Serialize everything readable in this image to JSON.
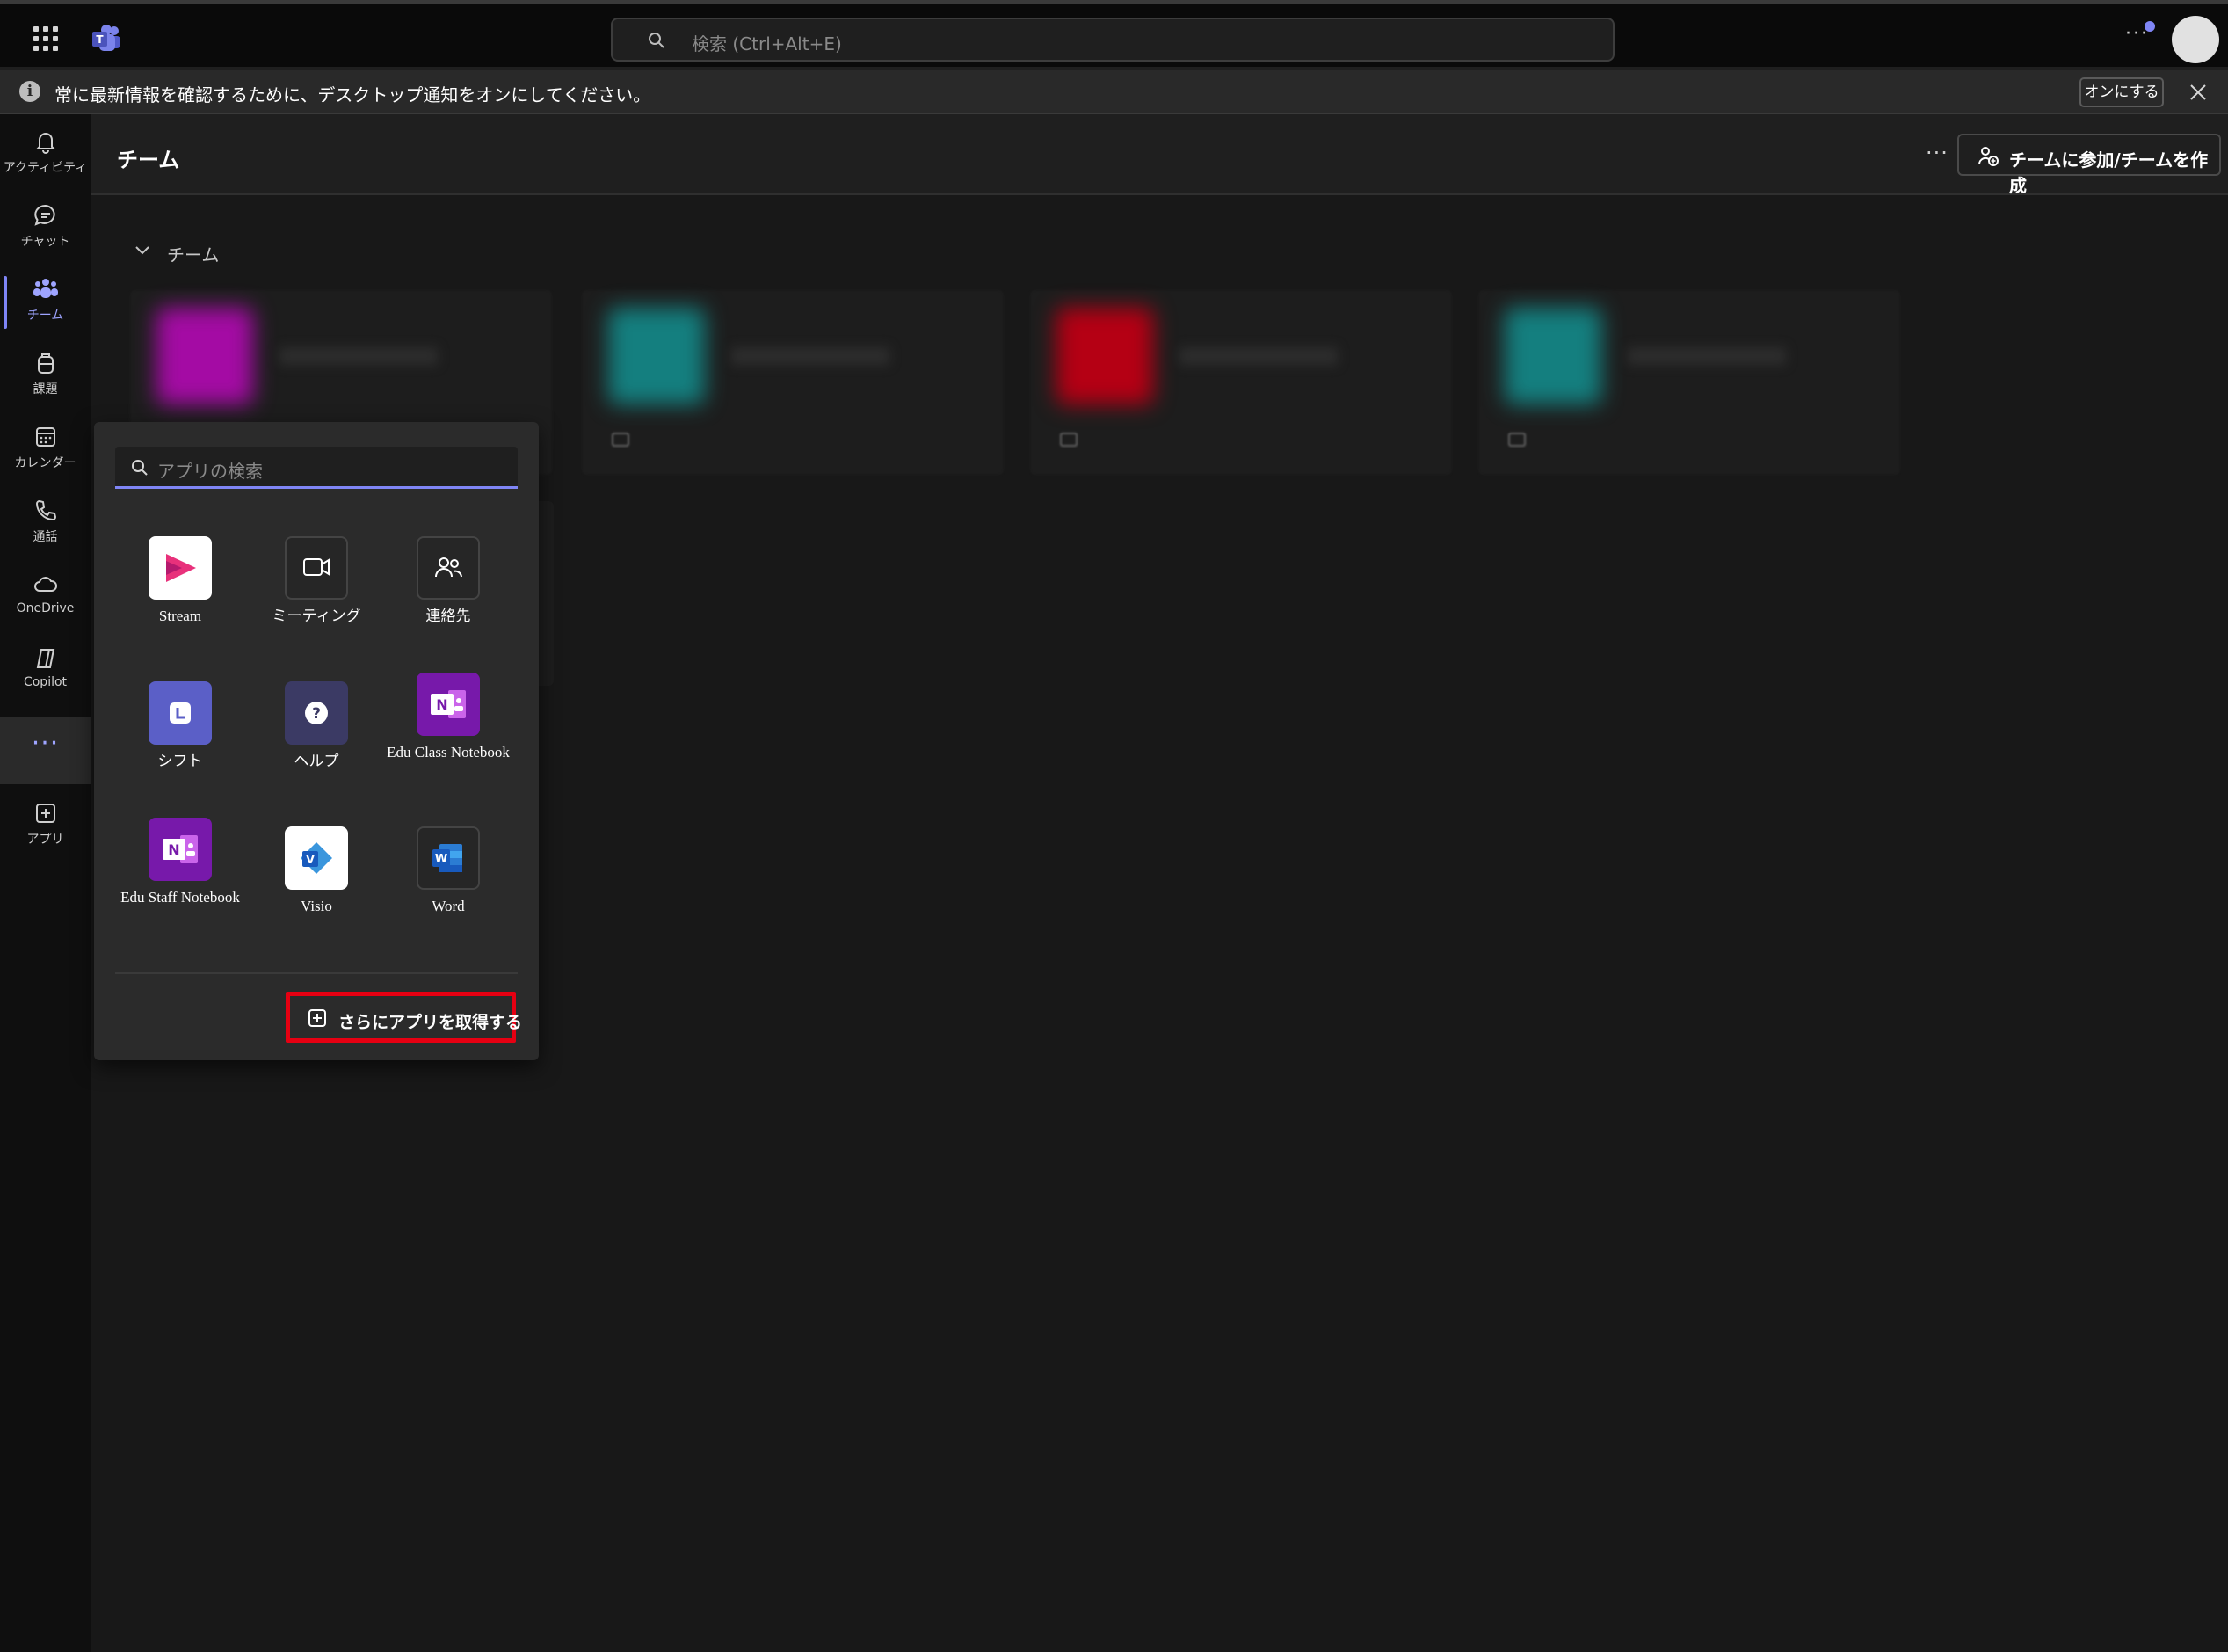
{
  "topbar": {
    "search_placeholder": "検索 (Ctrl+Alt+E)",
    "more_label": "···"
  },
  "notification": {
    "message": "常に最新情報を確認するために、デスクトップ通知をオンにしてください。",
    "turn_on_label": "オンにする"
  },
  "rail": {
    "items": [
      {
        "label": "アクティビティ",
        "icon": "bell-icon"
      },
      {
        "label": "チャット",
        "icon": "chat-icon"
      },
      {
        "label": "チーム",
        "icon": "teams-icon",
        "active": true
      },
      {
        "label": "課題",
        "icon": "backpack-icon"
      },
      {
        "label": "カレンダー",
        "icon": "calendar-icon"
      },
      {
        "label": "通話",
        "icon": "phone-icon"
      },
      {
        "label": "OneDrive",
        "icon": "cloud-icon"
      },
      {
        "label": "Copilot",
        "icon": "copilot-icon"
      }
    ],
    "more_label": "···",
    "apps_label": "アプリ"
  },
  "header": {
    "title": "チーム",
    "more_label": "···",
    "join_button_label": "チームに参加/チームを作成"
  },
  "section": {
    "label": "チーム"
  },
  "flyout": {
    "search_placeholder": "アプリの検索",
    "apps": [
      {
        "label": "Stream",
        "icon": "stream-icon"
      },
      {
        "label": "ミーティング",
        "icon": "meeting-icon"
      },
      {
        "label": "連絡先",
        "icon": "contacts-icon"
      },
      {
        "label": "シフト",
        "icon": "shifts-icon"
      },
      {
        "label": "ヘルプ",
        "icon": "help-icon"
      },
      {
        "label": "Edu Class Notebook",
        "icon": "onenote-class-icon"
      },
      {
        "label": "Edu Staff Notebook",
        "icon": "onenote-staff-icon"
      },
      {
        "label": "Visio",
        "icon": "visio-icon"
      },
      {
        "label": "Word",
        "icon": "word-icon"
      }
    ],
    "get_more_label": "さらにアプリを取得する"
  },
  "colors": {
    "accent": "#7f85f5",
    "highlight_box": "#e60012",
    "team_thumb_1": "#d20fd2",
    "team_thumb_2": "#1aa3a3",
    "team_thumb_3": "#e8001a",
    "team_thumb_4": "#1aa3a3"
  }
}
